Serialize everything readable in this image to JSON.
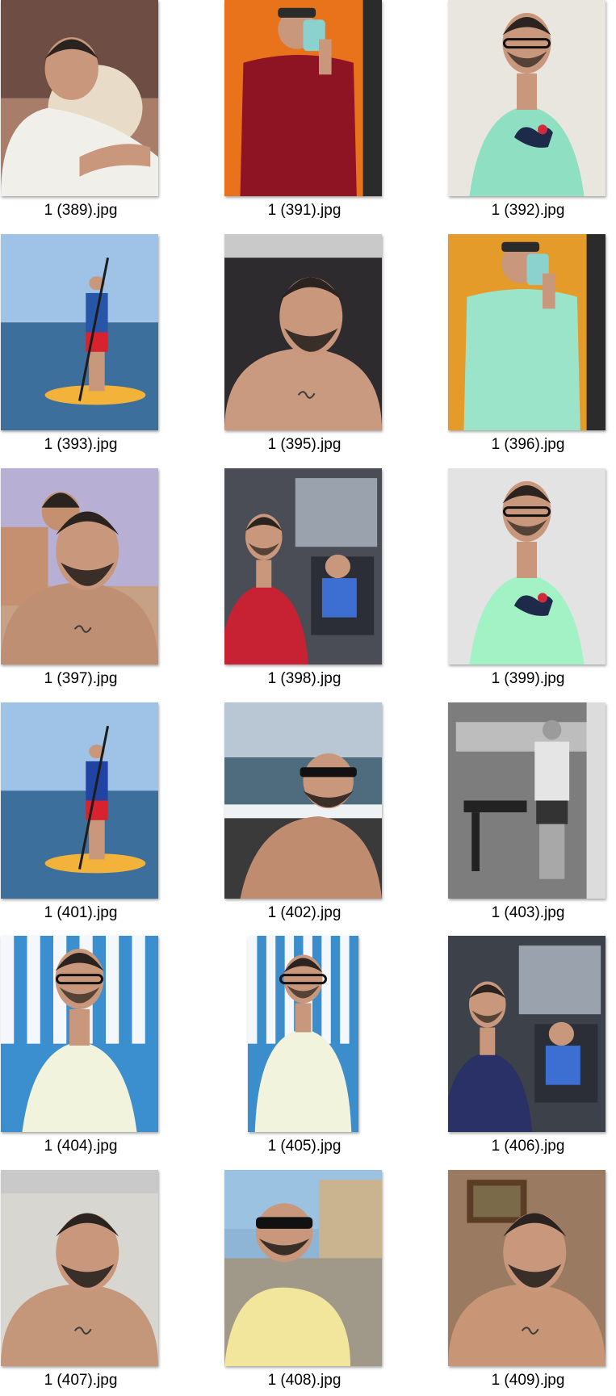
{
  "files": [
    {
      "name": "1 (389).jpg",
      "scene": "bed-pillow",
      "bg": "#a87d6a",
      "accent": "#f1efe9"
    },
    {
      "name": "1 (391).jpg",
      "scene": "mirror-selfie",
      "bg": "#e8731a",
      "accent": "#8e1424"
    },
    {
      "name": "1 (392).jpg",
      "scene": "portrait-glasses",
      "bg": "#e9e6df",
      "accent": "#8fe0c2"
    },
    {
      "name": "1 (393).jpg",
      "scene": "paddleboard",
      "bg": "#8fb7da",
      "accent": "#2756a8"
    },
    {
      "name": "1 (395).jpg",
      "scene": "bed-shirtless",
      "bg": "#2d2b2e",
      "accent": "#c99a80"
    },
    {
      "name": "1 (396).jpg",
      "scene": "mirror-selfie",
      "bg": "#e59b2a",
      "accent": "#9be3c9"
    },
    {
      "name": "1 (397).jpg",
      "scene": "beach-child",
      "bg": "#b7b0d4",
      "accent": "#bf8f74"
    },
    {
      "name": "1 (398).jpg",
      "scene": "car-selfie",
      "bg": "#4a4d55",
      "accent": "#c62233"
    },
    {
      "name": "1 (399).jpg",
      "scene": "portrait-glasses",
      "bg": "#e2e3e2",
      "accent": "#a2f2c5"
    },
    {
      "name": "1 (401).jpg",
      "scene": "paddleboard",
      "bg": "#7fb0dd",
      "accent": "#2143a3"
    },
    {
      "name": "1 (402).jpg",
      "scene": "sea-shirtless",
      "bg": "#a9b8c6",
      "accent": "#c08c6f"
    },
    {
      "name": "1 (403).jpg",
      "scene": "gym-bw",
      "bg": "#7d7d7d",
      "accent": "#e5e5e5"
    },
    {
      "name": "1 (404).jpg",
      "scene": "portrait-glasses",
      "bg": "#3c8fcf",
      "accent": "#f2f3dc"
    },
    {
      "name": "1 (405).jpg",
      "scene": "portrait-glasses-narrow",
      "bg": "#3b8dcc",
      "accent": "#f1f3dc"
    },
    {
      "name": "1 (406).jpg",
      "scene": "car-selfie",
      "bg": "#3d4149",
      "accent": "#2a3166"
    },
    {
      "name": "1 (407).jpg",
      "scene": "bed-shirtless",
      "bg": "#d8d6d1",
      "accent": "#c4977a"
    },
    {
      "name": "1 (408).jpg",
      "scene": "street-sunglasses",
      "bg": "#8fb5d6",
      "accent": "#f2e69c"
    },
    {
      "name": "1 (409).jpg",
      "scene": "indoor-shirtless",
      "bg": "#9a7a60",
      "accent": "#c89676"
    }
  ]
}
